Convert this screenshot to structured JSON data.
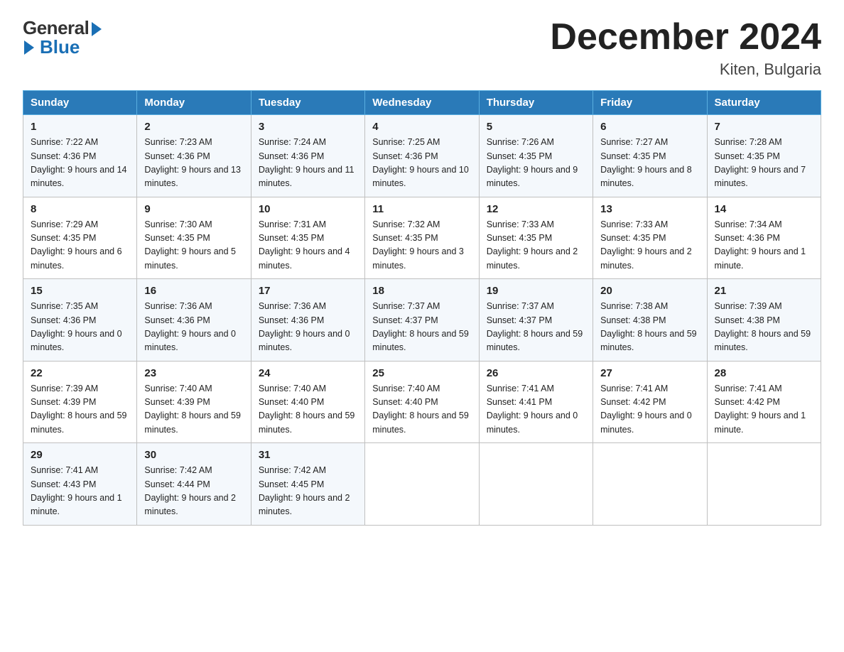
{
  "logo": {
    "general": "General",
    "blue": "Blue"
  },
  "title": "December 2024",
  "subtitle": "Kiten, Bulgaria",
  "days_of_week": [
    "Sunday",
    "Monday",
    "Tuesday",
    "Wednesday",
    "Thursday",
    "Friday",
    "Saturday"
  ],
  "weeks": [
    [
      {
        "num": "1",
        "sunrise": "7:22 AM",
        "sunset": "4:36 PM",
        "daylight": "9 hours and 14 minutes."
      },
      {
        "num": "2",
        "sunrise": "7:23 AM",
        "sunset": "4:36 PM",
        "daylight": "9 hours and 13 minutes."
      },
      {
        "num": "3",
        "sunrise": "7:24 AM",
        "sunset": "4:36 PM",
        "daylight": "9 hours and 11 minutes."
      },
      {
        "num": "4",
        "sunrise": "7:25 AM",
        "sunset": "4:36 PM",
        "daylight": "9 hours and 10 minutes."
      },
      {
        "num": "5",
        "sunrise": "7:26 AM",
        "sunset": "4:35 PM",
        "daylight": "9 hours and 9 minutes."
      },
      {
        "num": "6",
        "sunrise": "7:27 AM",
        "sunset": "4:35 PM",
        "daylight": "9 hours and 8 minutes."
      },
      {
        "num": "7",
        "sunrise": "7:28 AM",
        "sunset": "4:35 PM",
        "daylight": "9 hours and 7 minutes."
      }
    ],
    [
      {
        "num": "8",
        "sunrise": "7:29 AM",
        "sunset": "4:35 PM",
        "daylight": "9 hours and 6 minutes."
      },
      {
        "num": "9",
        "sunrise": "7:30 AM",
        "sunset": "4:35 PM",
        "daylight": "9 hours and 5 minutes."
      },
      {
        "num": "10",
        "sunrise": "7:31 AM",
        "sunset": "4:35 PM",
        "daylight": "9 hours and 4 minutes."
      },
      {
        "num": "11",
        "sunrise": "7:32 AM",
        "sunset": "4:35 PM",
        "daylight": "9 hours and 3 minutes."
      },
      {
        "num": "12",
        "sunrise": "7:33 AM",
        "sunset": "4:35 PM",
        "daylight": "9 hours and 2 minutes."
      },
      {
        "num": "13",
        "sunrise": "7:33 AM",
        "sunset": "4:35 PM",
        "daylight": "9 hours and 2 minutes."
      },
      {
        "num": "14",
        "sunrise": "7:34 AM",
        "sunset": "4:36 PM",
        "daylight": "9 hours and 1 minute."
      }
    ],
    [
      {
        "num": "15",
        "sunrise": "7:35 AM",
        "sunset": "4:36 PM",
        "daylight": "9 hours and 0 minutes."
      },
      {
        "num": "16",
        "sunrise": "7:36 AM",
        "sunset": "4:36 PM",
        "daylight": "9 hours and 0 minutes."
      },
      {
        "num": "17",
        "sunrise": "7:36 AM",
        "sunset": "4:36 PM",
        "daylight": "9 hours and 0 minutes."
      },
      {
        "num": "18",
        "sunrise": "7:37 AM",
        "sunset": "4:37 PM",
        "daylight": "8 hours and 59 minutes."
      },
      {
        "num": "19",
        "sunrise": "7:37 AM",
        "sunset": "4:37 PM",
        "daylight": "8 hours and 59 minutes."
      },
      {
        "num": "20",
        "sunrise": "7:38 AM",
        "sunset": "4:38 PM",
        "daylight": "8 hours and 59 minutes."
      },
      {
        "num": "21",
        "sunrise": "7:39 AM",
        "sunset": "4:38 PM",
        "daylight": "8 hours and 59 minutes."
      }
    ],
    [
      {
        "num": "22",
        "sunrise": "7:39 AM",
        "sunset": "4:39 PM",
        "daylight": "8 hours and 59 minutes."
      },
      {
        "num": "23",
        "sunrise": "7:40 AM",
        "sunset": "4:39 PM",
        "daylight": "8 hours and 59 minutes."
      },
      {
        "num": "24",
        "sunrise": "7:40 AM",
        "sunset": "4:40 PM",
        "daylight": "8 hours and 59 minutes."
      },
      {
        "num": "25",
        "sunrise": "7:40 AM",
        "sunset": "4:40 PM",
        "daylight": "8 hours and 59 minutes."
      },
      {
        "num": "26",
        "sunrise": "7:41 AM",
        "sunset": "4:41 PM",
        "daylight": "9 hours and 0 minutes."
      },
      {
        "num": "27",
        "sunrise": "7:41 AM",
        "sunset": "4:42 PM",
        "daylight": "9 hours and 0 minutes."
      },
      {
        "num": "28",
        "sunrise": "7:41 AM",
        "sunset": "4:42 PM",
        "daylight": "9 hours and 1 minute."
      }
    ],
    [
      {
        "num": "29",
        "sunrise": "7:41 AM",
        "sunset": "4:43 PM",
        "daylight": "9 hours and 1 minute."
      },
      {
        "num": "30",
        "sunrise": "7:42 AM",
        "sunset": "4:44 PM",
        "daylight": "9 hours and 2 minutes."
      },
      {
        "num": "31",
        "sunrise": "7:42 AM",
        "sunset": "4:45 PM",
        "daylight": "9 hours and 2 minutes."
      },
      null,
      null,
      null,
      null
    ]
  ],
  "labels": {
    "sunrise": "Sunrise:",
    "sunset": "Sunset:",
    "daylight": "Daylight:"
  }
}
